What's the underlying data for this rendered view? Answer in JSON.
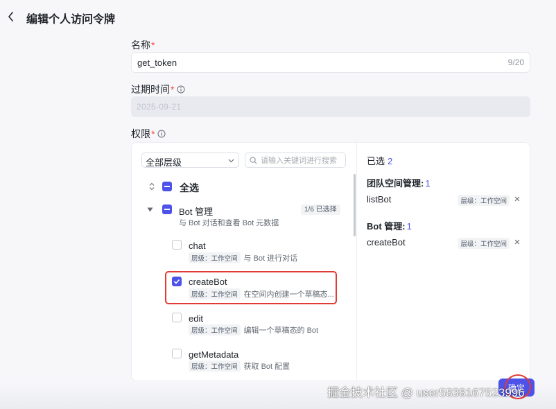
{
  "header": {
    "title": "编辑个人访问令牌"
  },
  "form": {
    "name_label": "名称",
    "required_mark": "*",
    "name_value": "get_token",
    "name_count": "9/20",
    "expiry_label": "过期时间",
    "expiry_value": "2025-09-21",
    "permission_label": "权限"
  },
  "permissions": {
    "level_select": "全部层级",
    "search_placeholder": "请输入关键词进行搜索",
    "select_all": "全选",
    "group": {
      "name": "Bot 管理",
      "badge": "1/6 已选择",
      "desc": "与 Bot 对话和查看 Bot 元数据"
    },
    "items": [
      {
        "name": "chat",
        "tag": "层级：工作空间",
        "desc": "与 Bot 进行对话",
        "checked": false
      },
      {
        "name": "createBot",
        "tag": "层级：工作空间",
        "desc": "在空间内创建一个草稿态...",
        "checked": true
      },
      {
        "name": "edit",
        "tag": "层级：工作空间",
        "desc": "编辑一个草稿态的 Bot",
        "checked": false
      },
      {
        "name": "getMetadata",
        "tag": "层级：工作空间",
        "desc": "获取 Bot 配置",
        "checked": false
      }
    ]
  },
  "selected": {
    "title": "已选",
    "count": "2",
    "groups": [
      {
        "name": "团队空间管理:",
        "count": "1",
        "items": [
          {
            "name": "listBot",
            "tag": "层级：工作空间"
          }
        ]
      },
      {
        "name": "Bot 管理:",
        "count": "1",
        "items": [
          {
            "name": "createBot",
            "tag": "层级：工作空间"
          }
        ]
      }
    ]
  },
  "footer": {
    "submit_label": "确定",
    "watermark": "掘金技术社区 @ user5838167523996"
  },
  "colors": {
    "accent": "#4d53e8",
    "required": "#f54a45",
    "highlight": "#e03b35"
  }
}
